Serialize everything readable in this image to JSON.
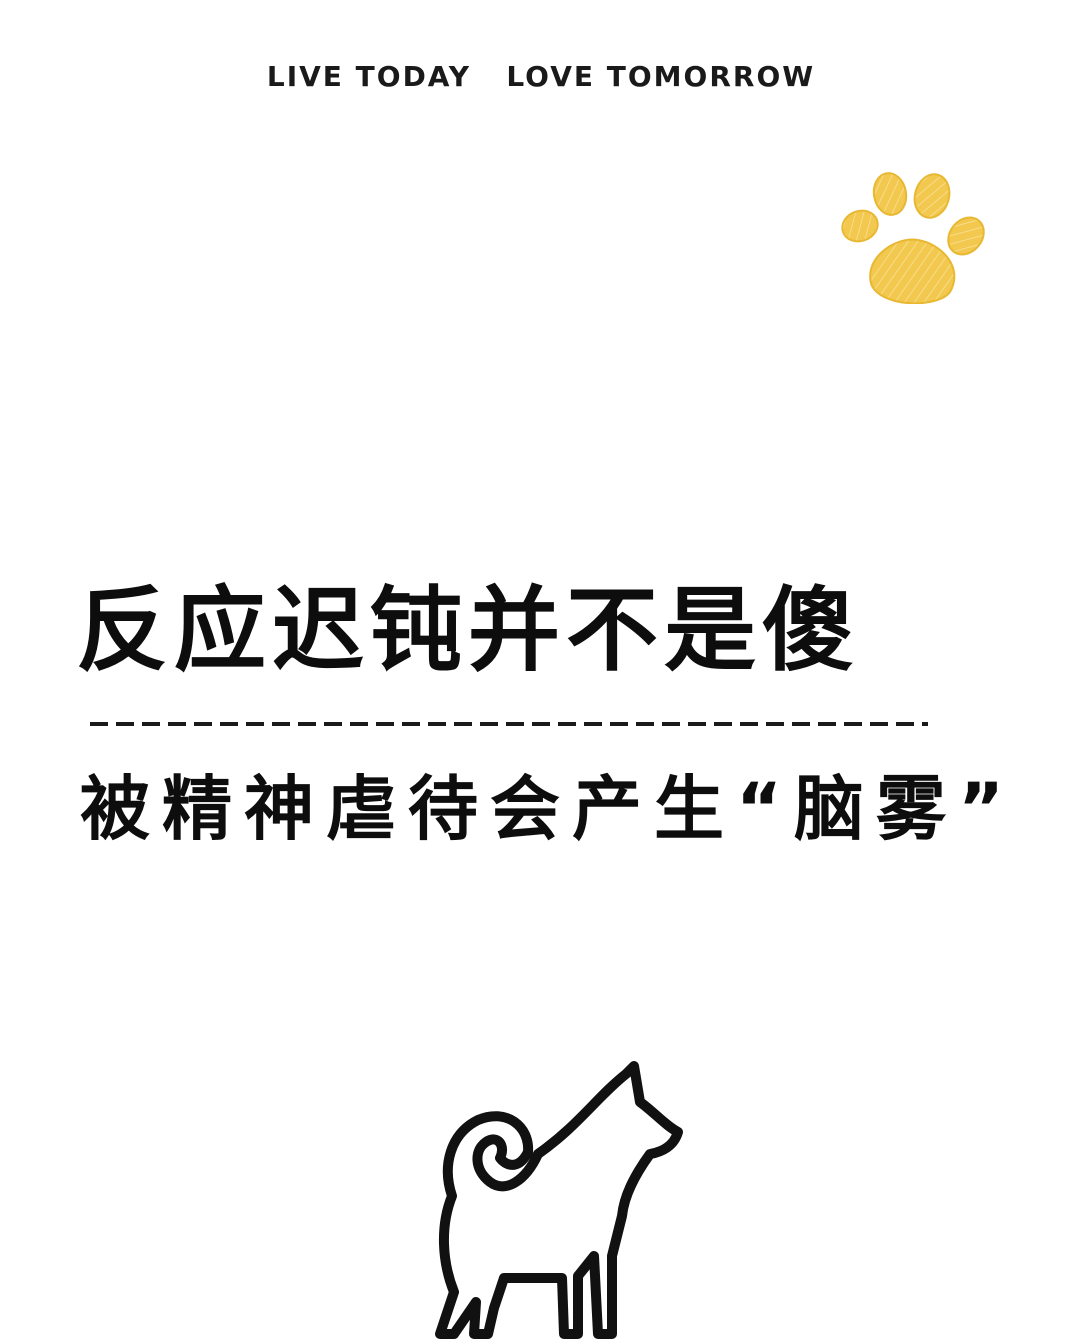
{
  "header": {
    "tagline": "LIVE TODAY   LOVE TOMORROW"
  },
  "main": {
    "headline": "反应迟钝并不是傻",
    "subline": "被精神虐待会产生“脑雾”"
  },
  "icons": {
    "paw": "paw-print-icon",
    "dog": "dog-icon"
  },
  "colors": {
    "paw_fill": "#f0c54a",
    "text": "#0d0d0d",
    "background": "#ffffff"
  }
}
